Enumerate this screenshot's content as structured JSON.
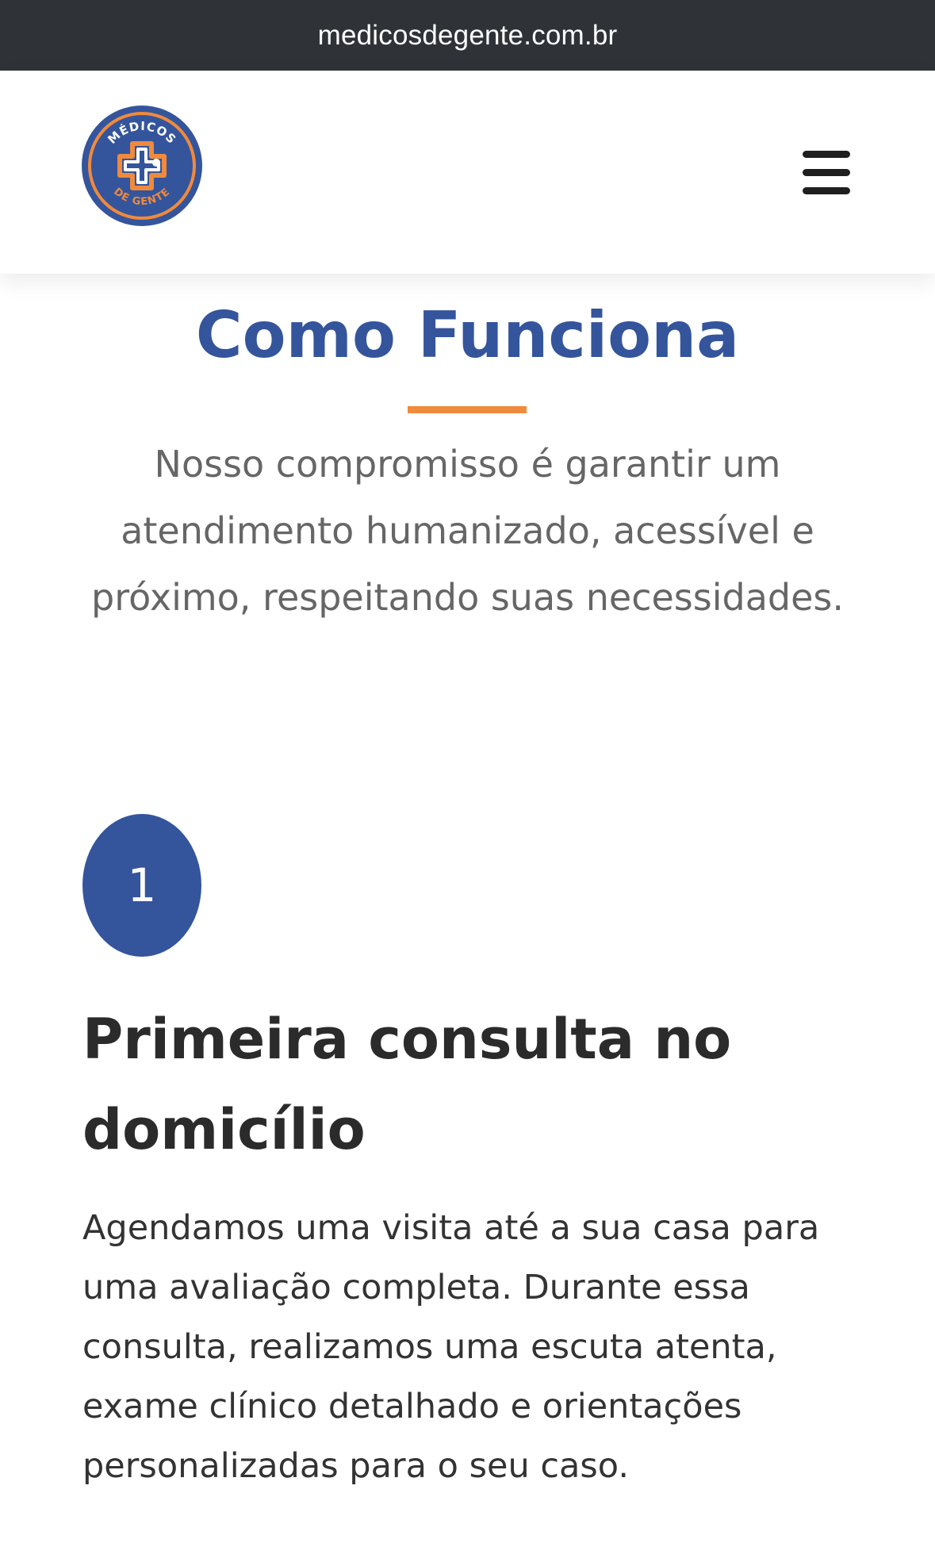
{
  "browser": {
    "url": "medicosdegente.com.br"
  },
  "header": {
    "logo": {
      "name": "medical-cross-logo",
      "text_top": "MÉDICOS",
      "text_bottom": "DE GENTE"
    },
    "menu_icon": "hamburger-menu-icon"
  },
  "section": {
    "title": "Como Funciona",
    "intro": "Nosso compromisso é garantir um atendimento humanizado, acessível e próximo, respeitando suas necessidades."
  },
  "step": {
    "number": "1",
    "title": "Primeira consulta no domicílio",
    "description": "Agendamos uma visita até a sua casa para uma avaliação completa. Durante essa consulta, realizamos uma escuta atenta, exame clínico detalhado e orientações personalizadas para o seu caso."
  },
  "colors": {
    "brand_blue": "#34559c",
    "accent_orange": "#f08a3c",
    "url_bar": "#2f3338"
  }
}
